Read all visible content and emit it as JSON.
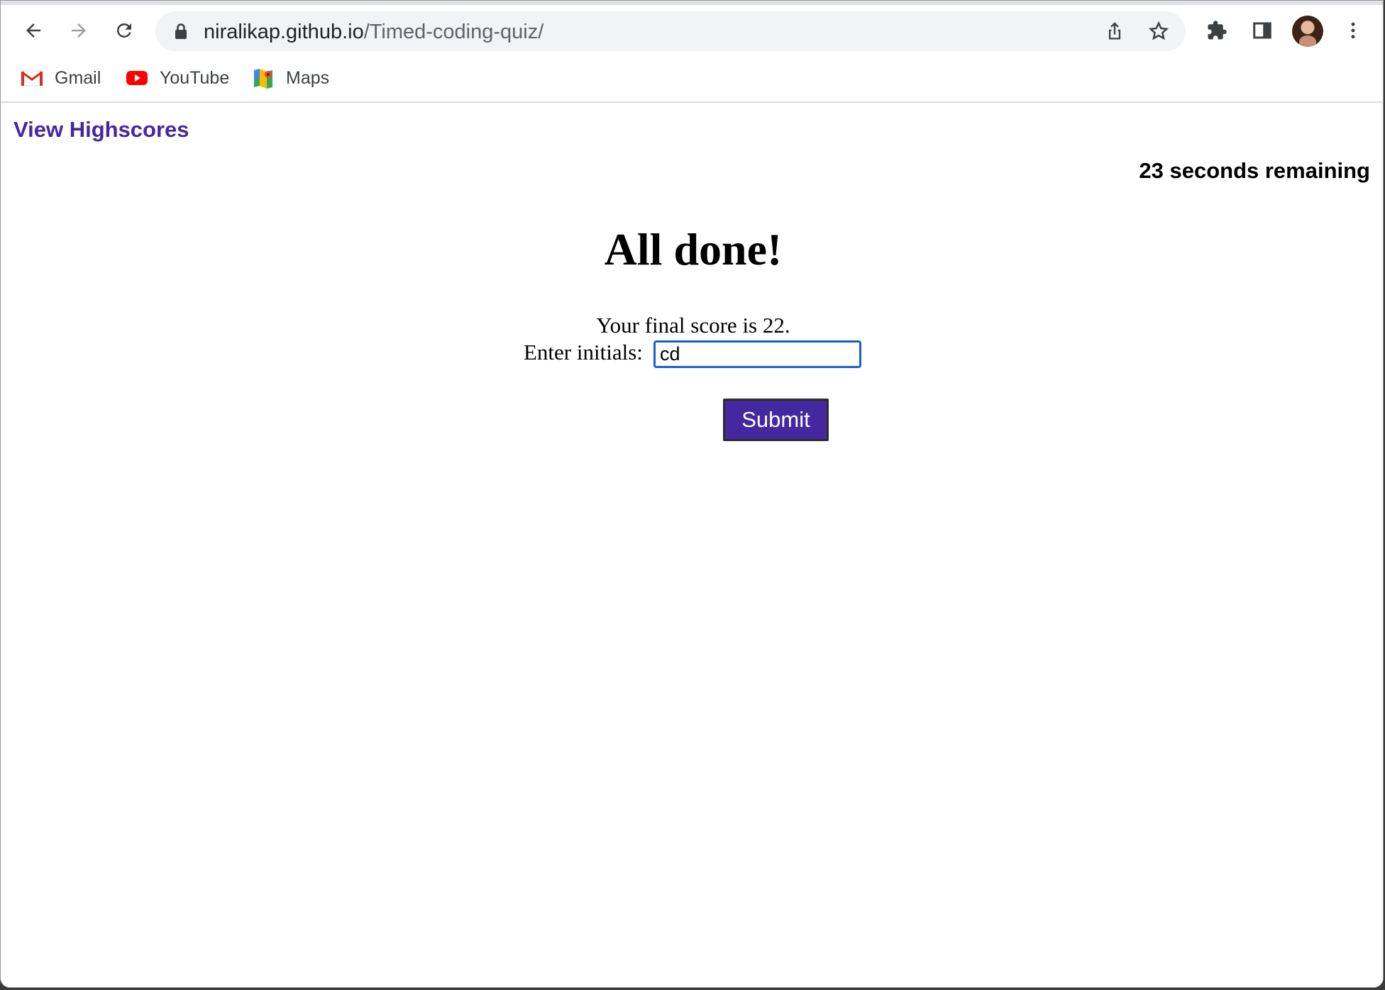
{
  "browser": {
    "url_host": "niralikap.github.io",
    "url_path": "/Timed-coding-quiz/",
    "icons": {
      "back": "arrow-left-icon",
      "forward": "arrow-right-icon",
      "reload": "reload-icon",
      "lock": "lock-icon",
      "share": "share-icon",
      "bookmark": "star-icon",
      "extensions": "puzzle-icon",
      "side_panel": "side-panel-icon",
      "profile": "avatar",
      "menu": "kebab-menu-icon"
    }
  },
  "bookmarks": [
    {
      "label": "Gmail",
      "icon": "gmail-icon"
    },
    {
      "label": "YouTube",
      "icon": "youtube-icon"
    },
    {
      "label": "Maps",
      "icon": "maps-icon"
    }
  ],
  "page": {
    "highscores_link": "View Highscores",
    "timer_text": "23 seconds remaining",
    "title": "All done!",
    "score_text": "Your final score is 22.",
    "initials_label": "Enter initials:",
    "initials_value": "cd",
    "submit_label": "Submit"
  },
  "colors": {
    "accent": "#4527a0",
    "focus_ring": "#1a5fd0"
  }
}
